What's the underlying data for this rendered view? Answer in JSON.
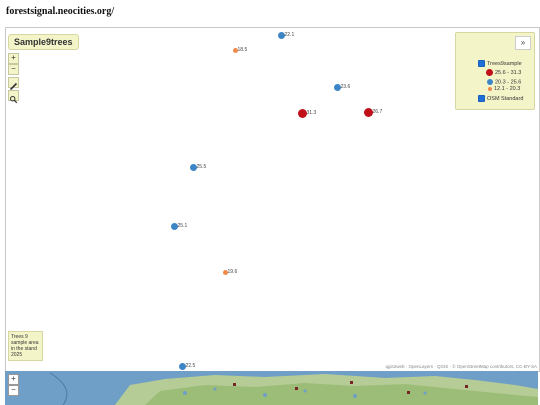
{
  "page_url": "forestsignal.neocities.org/",
  "map_title": "Sample9trees",
  "controls": {
    "zoom_in": "+",
    "zoom_out": "−",
    "collapse": "»"
  },
  "legend": {
    "layer_name": "Trees9sample",
    "classes": [
      {
        "label": "25.6 - 31.3",
        "color": "#c0101a"
      },
      {
        "label": "20.3 - 25.6",
        "color": "#3d85c6"
      },
      {
        "label": "12.1 - 20.3",
        "color": "#f08a4b"
      }
    ],
    "base_layer": "OSM Standard"
  },
  "points": [
    {
      "label": "22.1",
      "class": 1
    },
    {
      "label": "18.5",
      "class": 2
    },
    {
      "label": "23.6",
      "class": 1
    },
    {
      "label": "31.3",
      "class": 0
    },
    {
      "label": "26.7",
      "class": 0
    },
    {
      "label": "25.5",
      "class": 1
    },
    {
      "label": "25.1",
      "class": 1
    },
    {
      "label": "19.6",
      "class": 2
    },
    {
      "label": "22.5",
      "class": 1
    }
  ],
  "info_box": "Trees 9 sample area in the stand 2025",
  "attribution": "qgis2web · OpenLayers · QGIS · © OpenStreetMap contributors, CC-BY-SA",
  "overview": {
    "zoom_in": "+",
    "zoom_out": "−"
  }
}
